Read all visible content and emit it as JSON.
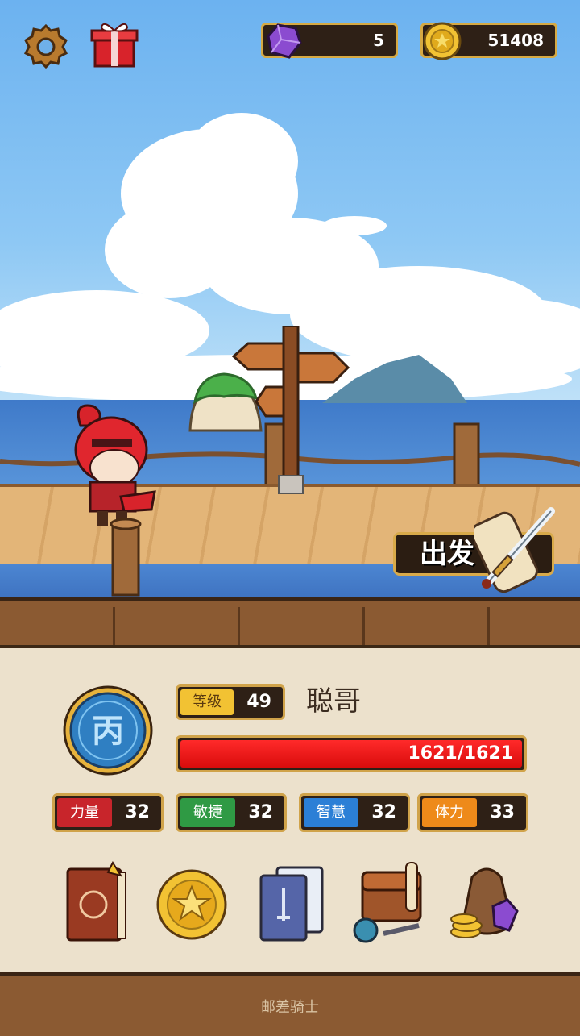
{
  "top_bar": {
    "gems": "5",
    "coins": "51408"
  },
  "scene": {
    "go_button_label": "出发"
  },
  "player": {
    "rank_glyph": "丙",
    "level_label": "等级",
    "level_value": "49",
    "name": "聪哥",
    "hp_text": "1621/1621",
    "hp_fraction": 1.0
  },
  "attributes": [
    {
      "label": "力量",
      "value": "32",
      "color": "#c8252b"
    },
    {
      "label": "敏捷",
      "value": "32",
      "color": "#2f9a44"
    },
    {
      "label": "智慧",
      "value": "32",
      "color": "#2b7fd6"
    },
    {
      "label": "体力",
      "value": "33",
      "color": "#ee8a1a"
    }
  ],
  "menu_icons": [
    "book-icon",
    "star-coin-icon",
    "cards-icon",
    "bag-icon",
    "treasure-sack-icon"
  ],
  "footer": {
    "title": "邮差骑士"
  },
  "colors": {
    "sky": "#6cb2f0",
    "panel": "#ece1cc",
    "wood": "#8b5a32",
    "gold_border": "#d0a34a"
  }
}
